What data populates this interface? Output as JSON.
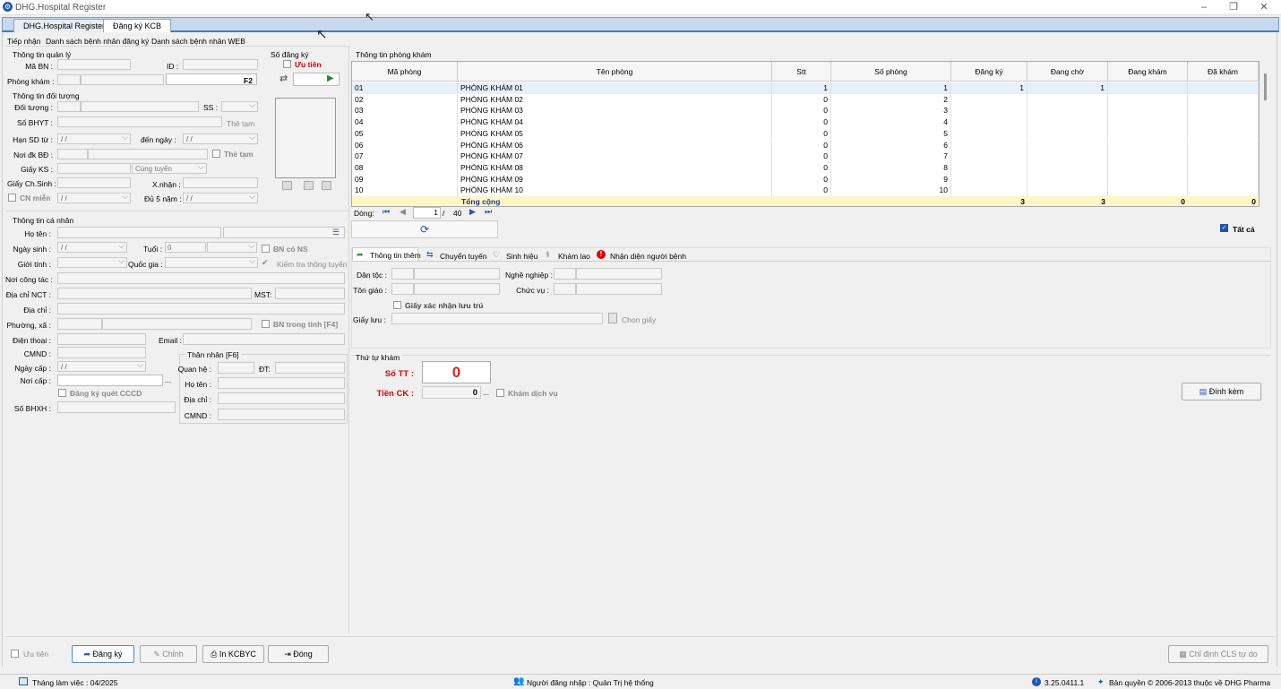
{
  "window": {
    "title": "DHG.Hospital Register",
    "minimize": "–",
    "restore": "❐",
    "close": "✕"
  },
  "tabs": [
    {
      "label": "DHG.Hospital Register"
    },
    {
      "label": "Đăng ký KCB"
    }
  ],
  "subtabs": [
    {
      "label": "Tiếp nhận"
    },
    {
      "label": "Danh sách bệnh nhân đăng ký"
    },
    {
      "label": "Danh sách bệnh nhân WEB"
    }
  ],
  "quanly": {
    "group": "Thông tin quản lý",
    "ma_bn": "Mã BN :",
    "id": "ID :",
    "phong_kham": "Phòng khám :",
    "f2": "F2"
  },
  "sodangky": {
    "group": "Số đăng ký",
    "uutien": "Ưu tiên"
  },
  "doituong": {
    "group": "Thông tin đối tượng",
    "doi_tuong": "Đối tượng :",
    "ss": "SS :",
    "so_bhyt": "Số BHYT :",
    "the_tam_btn": "Thẻ tạm",
    "han_sd_tu": "Hạn SD từ :",
    "date_blank": "/ /",
    "den_ngay": "đến ngày :",
    "noi_dk_bd": "Nơi đk BĐ :",
    "the_tam_chk": "Thẻ tạm",
    "giay_ks": "Giấy KS :",
    "cung_tuyen": "Cùng tuyến",
    "giay_chsinh": "Giấy Ch.Sinh :",
    "xnhan": "X.nhận :",
    "cn_mien": "CN miễn",
    "du_5_nam": "Đủ 5 năm :"
  },
  "canhan": {
    "group": "Thông tin cá nhân",
    "ho_ten": "Họ tên :",
    "ngay_sinh": "Ngày sinh :",
    "tuoi": "Tuổi :",
    "tuoi_val": "0",
    "bn_co_ns": "BN có NS",
    "gioi_tinh": "Giới tính :",
    "quoc_gia": "Quốc gia :",
    "kiem_tra": "Kiểm tra thông tuyến",
    "noi_cong_tac": "Nơi công tác :",
    "dia_chi_nct": "Địa chỉ NCT :",
    "mst": "MST:",
    "dia_chi": "Địa chỉ :",
    "phuong_xa": "Phường, xã :",
    "bn_trong_tinh": "BN trong tỉnh [F4]",
    "dien_thoai": "Điện thoại :",
    "email": "Email :",
    "cmnd": "CMND :",
    "ngay_cap": "Ngày cấp :",
    "noi_cap": "Nơi cấp :",
    "dots": "...",
    "dang_ky_cccd": "Đăng ký quét CCCD",
    "so_bhxh": "Số BHXH :"
  },
  "thannhan": {
    "group": "Thân nhân [F6]",
    "quan_he": "Quan hệ :",
    "dt": "ĐT:",
    "ho_ten": "Họ tên :",
    "dia_chi": "Địa chỉ :",
    "cmnd": "CMND :"
  },
  "phongkham": {
    "group": "Thông tin phòng khám",
    "columns": [
      "Mã phòng",
      "Tên phòng",
      "Stt",
      "Số phòng",
      "Đăng ký",
      "Đang chờ",
      "Đang khám",
      "Đã khám"
    ],
    "rows": [
      {
        "ma": "01",
        "ten": "PHÒNG KHÁM 01",
        "stt": "1",
        "so": "1",
        "dk": "1",
        "cho": "1",
        "kham": "",
        "da": ""
      },
      {
        "ma": "02",
        "ten": "PHÒNG KHÁM 02",
        "stt": "0",
        "so": "2",
        "dk": "",
        "cho": "",
        "kham": "",
        "da": ""
      },
      {
        "ma": "03",
        "ten": "PHÒNG KHÁM 03",
        "stt": "0",
        "so": "3",
        "dk": "",
        "cho": "",
        "kham": "",
        "da": ""
      },
      {
        "ma": "04",
        "ten": "PHÒNG KHÁM 04",
        "stt": "0",
        "so": "4",
        "dk": "",
        "cho": "",
        "kham": "",
        "da": ""
      },
      {
        "ma": "05",
        "ten": "PHÒNG KHÁM 05",
        "stt": "0",
        "so": "5",
        "dk": "",
        "cho": "",
        "kham": "",
        "da": ""
      },
      {
        "ma": "06",
        "ten": "PHÒNG KHÁM 06",
        "stt": "0",
        "so": "6",
        "dk": "",
        "cho": "",
        "kham": "",
        "da": ""
      },
      {
        "ma": "07",
        "ten": "PHÒNG KHÁM 07",
        "stt": "0",
        "so": "7",
        "dk": "",
        "cho": "",
        "kham": "",
        "da": ""
      },
      {
        "ma": "08",
        "ten": "PHÒNG KHÁM 08",
        "stt": "0",
        "so": "8",
        "dk": "",
        "cho": "",
        "kham": "",
        "da": ""
      },
      {
        "ma": "09",
        "ten": "PHÒNG KHÁM 09",
        "stt": "0",
        "so": "9",
        "dk": "",
        "cho": "",
        "kham": "",
        "da": ""
      },
      {
        "ma": "10",
        "ten": "PHÒNG KHÁM 10",
        "stt": "0",
        "so": "10",
        "dk": "",
        "cho": "",
        "kham": "",
        "da": ""
      }
    ],
    "total": {
      "label": "Tổng cộng",
      "dk": "3",
      "cho": "3",
      "kham": "0",
      "da": "0"
    },
    "nav": {
      "label": "Dòng:",
      "page": "1",
      "sep": "/",
      "total": "40"
    },
    "tat_ca": "Tất cả"
  },
  "infotabs": [
    {
      "label": "Thông tin thêm"
    },
    {
      "label": "Chuyển tuyến"
    },
    {
      "label": "Sinh hiệu"
    },
    {
      "label": "Khám lao"
    },
    {
      "label": "Nhận diện người bệnh"
    }
  ],
  "thongtinthem": {
    "dan_toc": "Dân tộc :",
    "nghe_nghiep": "Nghề nghiệp :",
    "ton_giao": "Tôn giáo :",
    "chuc_vu": "Chức vụ :",
    "giay_xac_nhan": "Giấy xác nhận lưu trú",
    "giay_luu": "Giấy lưu :",
    "chon_giay": "Chọn giấy"
  },
  "thutukham": {
    "group": "Thứ tự khám",
    "so_tt": "Số TT :",
    "so_tt_val": "0",
    "tien_ck": "Tiền CK :",
    "tien_ck_val": "0",
    "dots": "...",
    "kham_dich_vu": "Khám dịch vụ",
    "dinh_kem": "Đính kèm"
  },
  "bottom": {
    "uu_tien": "Ưu tiên",
    "dang_ky": "Đăng ký",
    "chinh": "Chỉnh",
    "in_kcbyc": "In KCBYC",
    "dong": "Đóng",
    "chi_dinh": "Chỉ định CLS tự do"
  },
  "statusbar": {
    "thang": "Tháng làm việc : 04/2025",
    "user": "Người đăng nhập : Quản Trị hệ thống",
    "version": "3.25.0411.1",
    "copyright": "Bản quyền © 2006-2013 thuộc về DHG Pharma"
  },
  "colors": {
    "accent_red": "#dd0000",
    "total_row": "#fff6c8",
    "selected_row": "#e6f0fb"
  }
}
